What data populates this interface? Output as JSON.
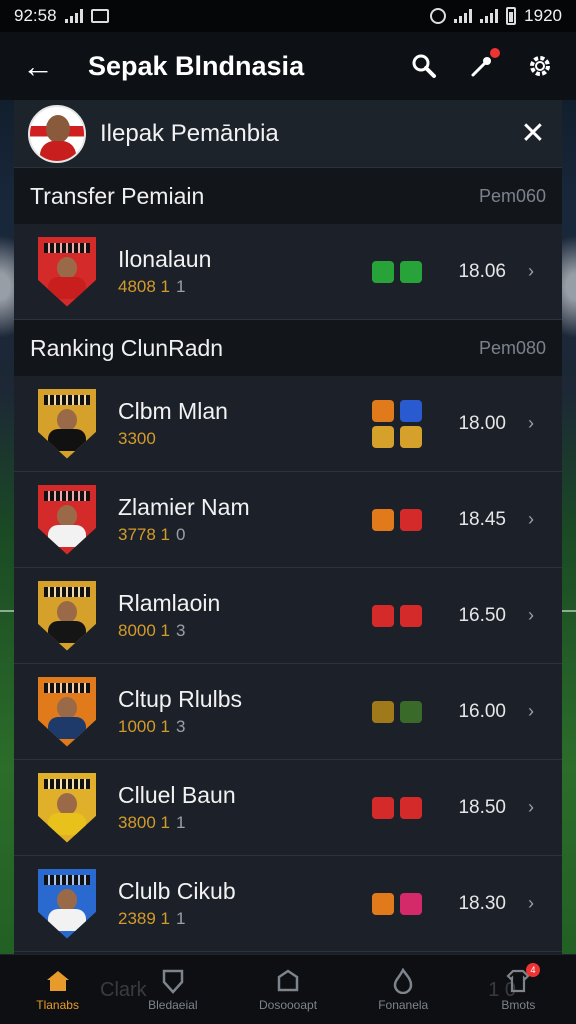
{
  "status_bar": {
    "time": "92:58",
    "clock": "1920"
  },
  "app_bar": {
    "title": "Sepak Blndnasia"
  },
  "profile": {
    "name": "Ilepak Pemānbia"
  },
  "sections": [
    {
      "title": "Transfer Pemiain",
      "meta": "Pem060",
      "rows": [
        {
          "name": "Ilonalaun",
          "sub": "4808 1",
          "sub_extra": "1",
          "time": "18.06",
          "crest_color": "#d42a2a",
          "shirt": "#c81e1e",
          "badges": [
            [
              "#27a33a",
              "#27a33a"
            ]
          ]
        }
      ]
    },
    {
      "title": "Ranking ClunRadn",
      "meta": "Pem080",
      "rows": [
        {
          "name": "Clbm Mlan",
          "sub": "3300",
          "sub_extra": "",
          "time": "18.00",
          "crest_color": "#d6a12a",
          "shirt": "#111111",
          "badges": [
            [
              "#e07a1a",
              "#2a5ad0"
            ],
            [
              "#d6a12a",
              "#d6a12a"
            ]
          ]
        },
        {
          "name": "Zlamier Nam",
          "sub": "3778 1",
          "sub_extra": "0",
          "time": "18.45",
          "crest_color": "#d42a2a",
          "shirt": "#f2f2f2",
          "badges": [
            [
              "#e07a1a",
              "#d42a2a"
            ]
          ]
        },
        {
          "name": "Rlamlaoin",
          "sub": "8000 1",
          "sub_extra": "3",
          "time": "16.50",
          "crest_color": "#d6a12a",
          "shirt": "#151515",
          "badges": [
            [
              "#d42a2a",
              "#d42a2a"
            ]
          ]
        },
        {
          "name": "Cltup Rlulbs",
          "sub": "1000 1",
          "sub_extra": "3",
          "time": "16.00",
          "crest_color": "#e07a1a",
          "shirt": "#1e3a6a",
          "badges": [
            [
              "#a07a1a",
              "#3a6a2a"
            ]
          ]
        },
        {
          "name": "Clluel Baun",
          "sub": "3800 1",
          "sub_extra": "1",
          "time": "18.50",
          "crest_color": "#e0b02a",
          "shirt": "#e8c21a",
          "badges": [
            [
              "#d42a2a",
              "#d42a2a"
            ]
          ]
        },
        {
          "name": "Clulb Cikub",
          "sub": "2389 1",
          "sub_extra": "1",
          "time": "18.30",
          "crest_color": "#2a6ad0",
          "shirt": "#f2f2f2",
          "badges": [
            [
              "#e07a1a",
              "#d42a6a"
            ]
          ]
        }
      ]
    }
  ],
  "bottom_nav": {
    "items": [
      {
        "label": "Tlanabs",
        "icon": "home-icon"
      },
      {
        "label": "Bledaeial",
        "icon": "shield-icon"
      },
      {
        "label": "Dosoooapt",
        "icon": "trophy-icon"
      },
      {
        "label": "Fonanela",
        "icon": "fire-icon"
      },
      {
        "label": "Bmots",
        "icon": "shirt-icon",
        "badge": "4"
      }
    ]
  },
  "ghost_text": {
    "left": "Clark",
    "right": "1 0"
  },
  "colors": {
    "accent": "#e89a2a",
    "panel": "#1a1f26",
    "header": "#0d1116"
  }
}
